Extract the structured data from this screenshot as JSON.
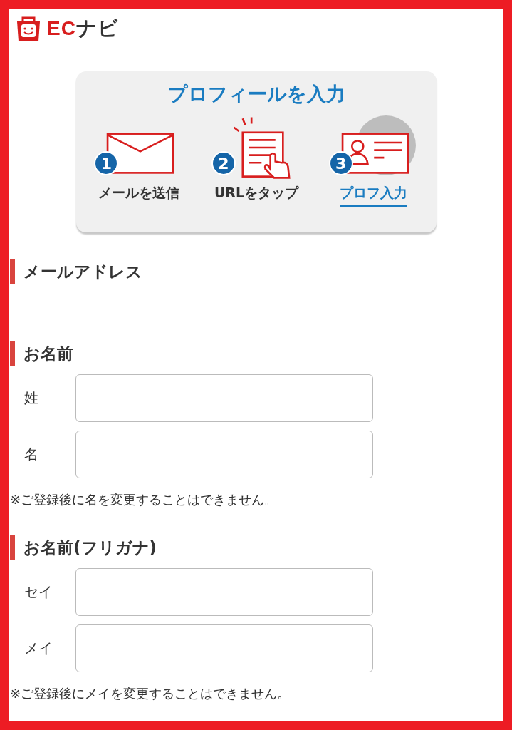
{
  "logo": {
    "brand_red": "EC",
    "brand_dark": "ナビ"
  },
  "steps_panel": {
    "title": "プロフィールを入力",
    "steps": [
      {
        "number": "1",
        "label": "メールを送信",
        "kind": "envelope",
        "selected": false
      },
      {
        "number": "2",
        "label": "URLをタップ",
        "kind": "document",
        "selected": false
      },
      {
        "number": "3",
        "label": "プロフ入力",
        "kind": "card",
        "selected": true
      }
    ]
  },
  "sections": [
    {
      "heading": "メールアドレス"
    },
    {
      "heading": "お名前",
      "fields": [
        {
          "label": "姓"
        },
        {
          "label": "名"
        }
      ],
      "note": "※ご登録後に名を変更することはできません。"
    },
    {
      "heading": "お名前(フリガナ)",
      "fields": [
        {
          "label": "セイ"
        },
        {
          "label": "メイ"
        }
      ],
      "note": "※ご登録後にメイを変更することはできません。"
    }
  ]
}
